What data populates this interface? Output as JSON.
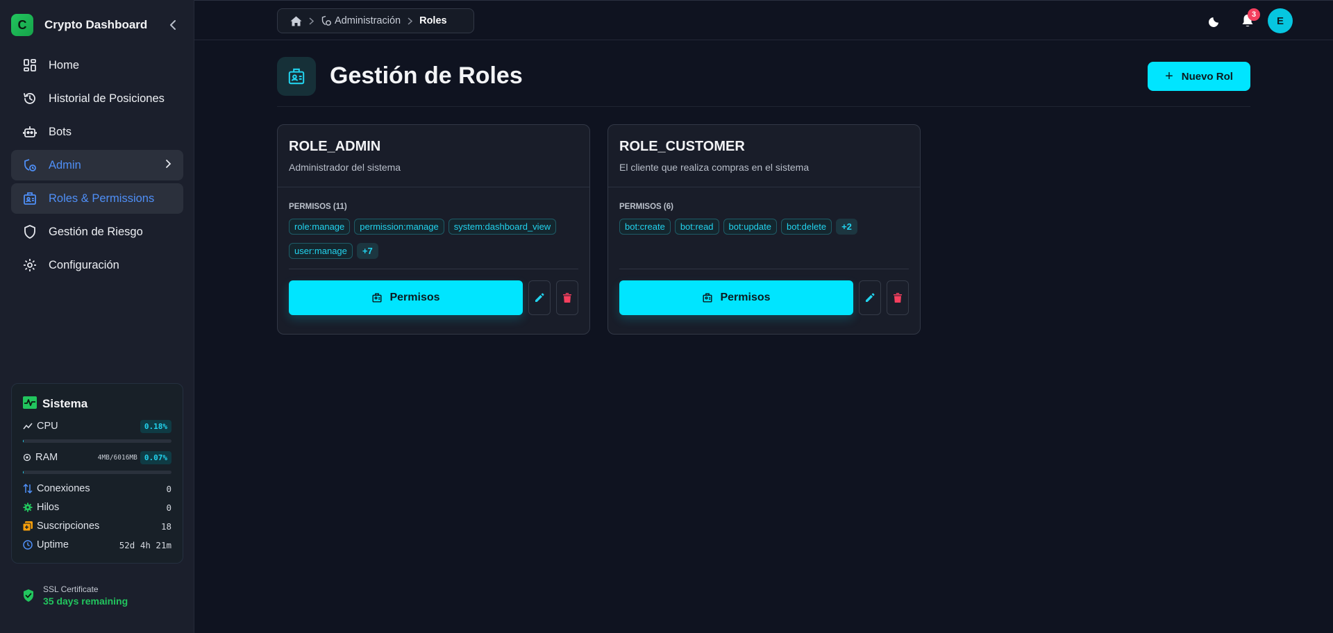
{
  "app": {
    "logo_letter": "C",
    "title": "Crypto Dashboard"
  },
  "sidebar": {
    "items": [
      {
        "label": "Home",
        "icon": "dashboard-grid-icon"
      },
      {
        "label": "Historial de Posiciones",
        "icon": "history-icon"
      },
      {
        "label": "Bots",
        "icon": "robot-icon"
      },
      {
        "label": "Admin",
        "icon": "admin-shield-icon"
      },
      {
        "label": "Roles & Permissions",
        "icon": "id-badge-icon"
      },
      {
        "label": "Gestión de Riesgo",
        "icon": "shield-icon"
      },
      {
        "label": "Configuración",
        "icon": "gear-icon"
      }
    ]
  },
  "system": {
    "title": "Sistema",
    "cpu": {
      "label": "CPU",
      "value": "0.18%",
      "level": 0.0018
    },
    "ram": {
      "label": "RAM",
      "detail": "4MB/6016MB",
      "value": "0.07%",
      "level": 0.0007
    },
    "conexiones": {
      "label": "Conexiones",
      "value": "0"
    },
    "hilos": {
      "label": "Hilos",
      "value": "0"
    },
    "suscripciones": {
      "label": "Suscripciones",
      "value": "18"
    },
    "uptime": {
      "label": "Uptime",
      "value": "52d 4h 21m"
    }
  },
  "ssl": {
    "title": "SSL Certificate",
    "status": "35 days remaining"
  },
  "breadcrumb": {
    "parent": "Administración",
    "current": "Roles"
  },
  "topbar": {
    "notification_count": "3",
    "avatar_letter": "E"
  },
  "page": {
    "title": "Gestión de Roles",
    "new_button": "Nuevo Rol",
    "plus": "+"
  },
  "roles": [
    {
      "name": "ROLE_ADMIN",
      "description": "Administrador del sistema",
      "permissions_label": "PERMISOS (11)",
      "tags": [
        "role:manage",
        "permission:manage",
        "system:dashboard_view",
        "user:manage"
      ],
      "more": "+7",
      "button": "Permisos"
    },
    {
      "name": "ROLE_CUSTOMER",
      "description": "El cliente que realiza compras en el sistema",
      "permissions_label": "PERMISOS (6)",
      "tags": [
        "bot:create",
        "bot:read",
        "bot:update",
        "bot:delete"
      ],
      "more": "+2",
      "button": "Permisos"
    }
  ],
  "colors": {
    "accent": "#00e5ff",
    "link": "#4f8ff7",
    "danger": "#f43f5e",
    "success": "#22c55e"
  }
}
